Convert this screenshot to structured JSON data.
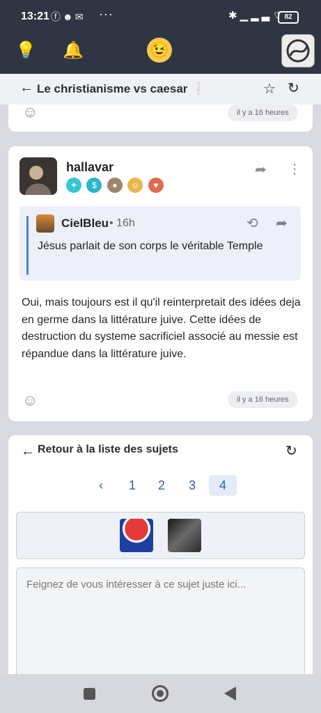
{
  "status_bar": {
    "time": "13:21",
    "notification_icons": [
      "facebook-icon",
      "discord-icon",
      "chat-icon"
    ],
    "more": "···",
    "system_icons": [
      "bluetooth-icon",
      "signal-icon",
      "wifi-icon"
    ],
    "battery": "82"
  },
  "header": {
    "left_icons": [
      "lightbulb-icon",
      "bell-icon"
    ],
    "logo_icon": "smiley-logo-icon",
    "avatar_icon": "user-avatar"
  },
  "topic": {
    "title": "Le christianisme vs caesar",
    "title_suffix": "❕"
  },
  "prev_post": {
    "time": "il y a 16 heures"
  },
  "post": {
    "author": "hallavar",
    "badges": [
      {
        "icon": "badge-1",
        "color": "#35c6d4"
      },
      {
        "icon": "badge-2",
        "color": "#2bb7c9"
      },
      {
        "icon": "badge-3",
        "color": "#a0846a"
      },
      {
        "icon": "badge-4",
        "color": "#e9b64a"
      },
      {
        "icon": "badge-5",
        "color": "#e06a50"
      }
    ],
    "quote": {
      "author": "CielBleu",
      "time": "• 16h",
      "text": "Jésus parlait de son corps le véritable Temple"
    },
    "body": "Oui, mais toujours est il qu'il reinterpretait des idées deja en germe dans la littérature juive. Cette idées de destruction du systeme sacrificiel associé au messie est répandue dans la littérature juive.",
    "time": "il y a 16 heures"
  },
  "footer": {
    "back_label": "Retour à la liste des sujets",
    "pagination": {
      "prev": "‹",
      "pages": [
        "1",
        "2",
        "3",
        "4"
      ],
      "current": "4"
    },
    "reply_placeholder": "Feignez de vous intéresser à ce sujet juste ici..."
  },
  "colors": {
    "header_bg": "#2f3542",
    "accent": "#2d5db5",
    "quote_bar": "#4f7fd6"
  }
}
